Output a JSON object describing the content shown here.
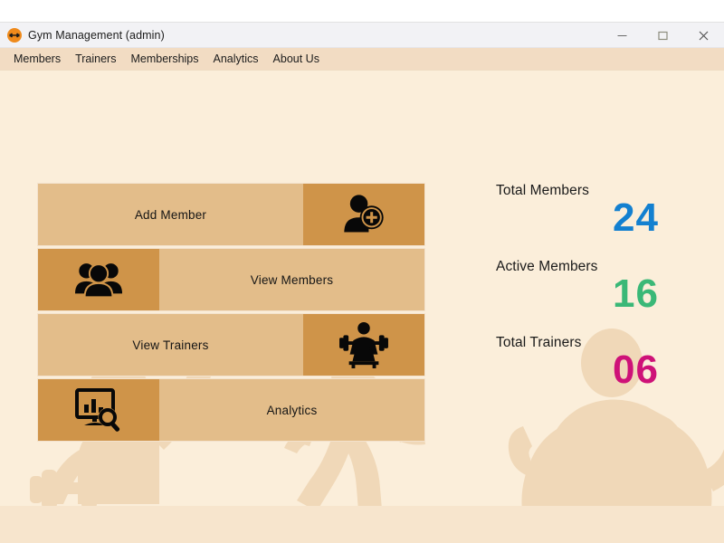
{
  "window": {
    "title": "Gym Management (admin)",
    "app_icon": "dumbbell-icon",
    "controls": {
      "minimize": "minimize-icon",
      "maximize": "maximize-icon",
      "close": "close-icon"
    }
  },
  "menubar": {
    "items": [
      {
        "label": "Members"
      },
      {
        "label": "Trainers"
      },
      {
        "label": "Memberships"
      },
      {
        "label": "Analytics"
      },
      {
        "label": "About Us"
      }
    ]
  },
  "actions": [
    {
      "label": "Add Member",
      "icon": "user-plus-icon",
      "icon_side": "right"
    },
    {
      "label": "View Members",
      "icon": "user-group-icon",
      "icon_side": "left"
    },
    {
      "label": "View Trainers",
      "icon": "weightlifter-icon",
      "icon_side": "right"
    },
    {
      "label": "Analytics",
      "icon": "chart-search-icon",
      "icon_side": "left"
    }
  ],
  "stats": [
    {
      "label": "Total Members",
      "value": "24",
      "color": "#1380d0"
    },
    {
      "label": "Active Members",
      "value": "16",
      "color": "#3ab877"
    },
    {
      "label": "Total Trainers",
      "value": "06",
      "color": "#ce1278"
    }
  ],
  "theme": {
    "content_bg": "#fbeeda",
    "menubar_bg": "#f2dcc3",
    "button_label_bg": "#e3bd8a",
    "button_icon_bg": "#cf9449",
    "silhouette": "#f0d8b8",
    "accent_orange": "#ef8a1b"
  }
}
